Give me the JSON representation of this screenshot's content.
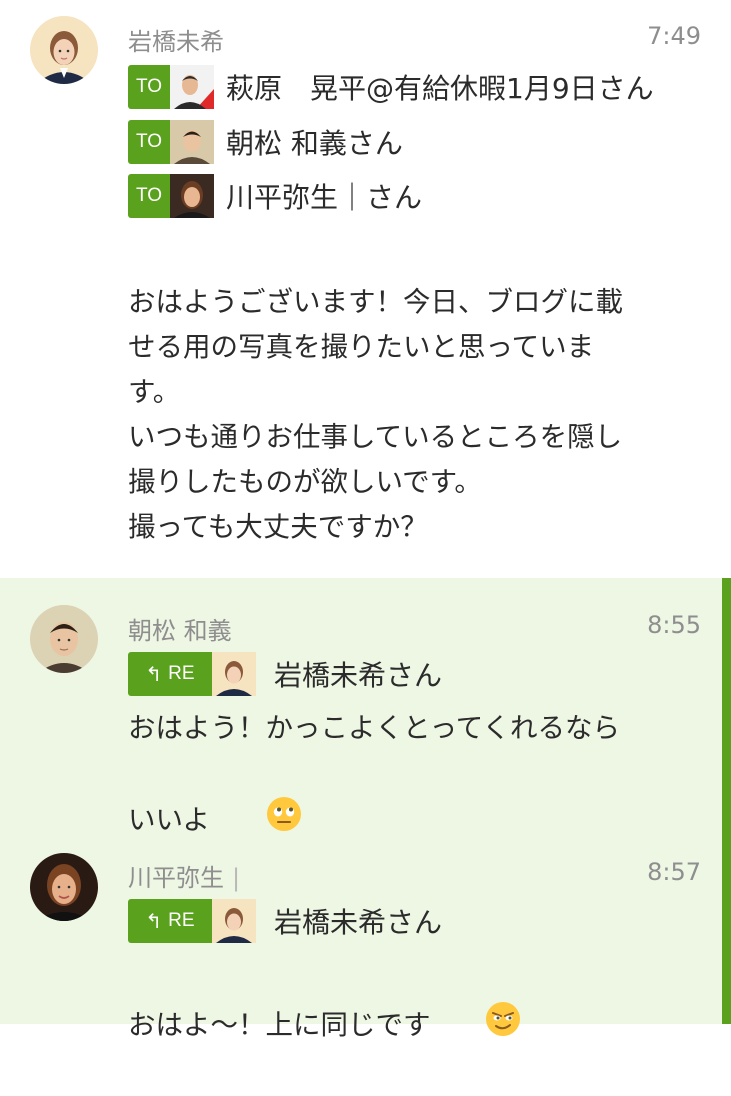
{
  "messages": [
    {
      "sender": "岩橋未希",
      "time": "7:49",
      "to_tag": "TO",
      "recipients": [
        {
          "name": "萩原　晃平@有給休暇1月9日さん",
          "avatar_icon": "man-avatar-red"
        },
        {
          "name": "朝松 和義さん",
          "avatar_icon": "man-avatar"
        },
        {
          "name": "川平弥生｜さん",
          "avatar_icon": "woman-avatar"
        }
      ],
      "lines": [
        "おはようございます！今日、ブログに載",
        "せる用の写真を撮りたいと思っていま",
        "す。",
        "いつも通りお仕事しているところを隠し",
        "撮りしたものが欲しいです。",
        "撮っても大丈夫ですか？"
      ]
    },
    {
      "sender": "朝松 和義",
      "time": "8:55",
      "re_tag": "RE",
      "reply_to": "岩橋未希さん",
      "lines": [
        "おはよう！かっこよくとってくれるなら",
        "いいよ"
      ],
      "emoji_icon": "rolling-eyes-emoji"
    },
    {
      "sender": "川平弥生",
      "time": "8:57",
      "re_tag": "RE",
      "reply_to": "岩橋未希さん",
      "lines": [
        "おはよ〜！上に同じです"
      ],
      "emoji_icon": "smirking-emoji"
    }
  ],
  "colors": {
    "accent": "#5aa21e",
    "highlight_bg": "#eef6e4",
    "meta_text": "#8e8e8e"
  }
}
